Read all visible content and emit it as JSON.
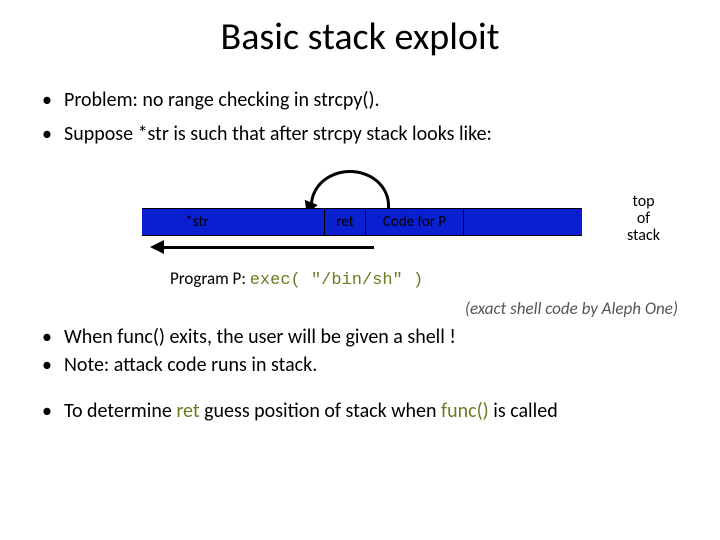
{
  "title": "Basic stack exploit",
  "bullets": {
    "b1_a": "Problem:   no range checking in  ",
    "b1_b": "strcpy().",
    "b2_a": "Suppose    ",
    "b2_b": "*str",
    "b2_c": "   is such that after  ",
    "b2_d": "strcpy",
    "b2_e": "  stack looks like:"
  },
  "diagram": {
    "seg_str": "*str",
    "seg_ret": "ret",
    "seg_code": "Code for P",
    "top_l1": "top",
    "top_l2": "of",
    "top_l3": "stack",
    "prog_label": "Program P:   ",
    "prog_code": "exec( \"/bin/sh\" )"
  },
  "credit": "(exact shell code by Aleph One)",
  "bullets2": {
    "c1_a": "When   ",
    "c1_b": "func()",
    "c1_c": "   exits,  the user will be given a shell  !",
    "c2": "Note:  attack code runs in stack."
  },
  "bullets3": {
    "d1_a": "To determine ",
    "d1_b": "ret",
    "d1_c": " guess position of stack when ",
    "d1_d": "func()",
    "d1_e": " is called"
  }
}
